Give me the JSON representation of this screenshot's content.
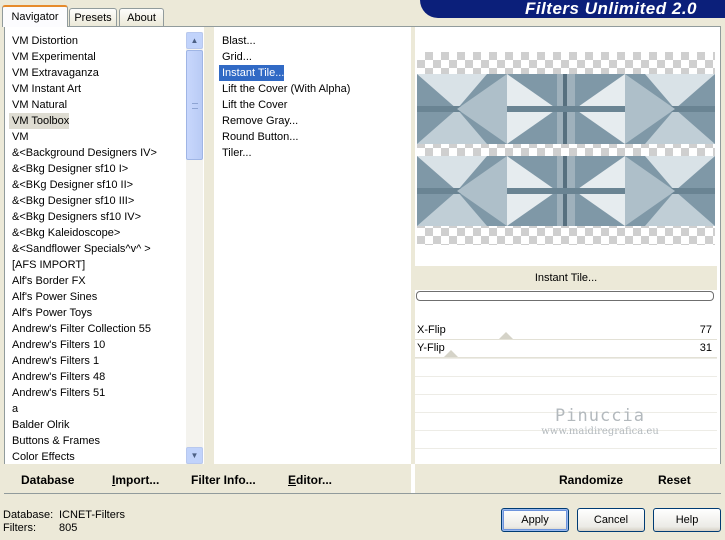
{
  "tabs": [
    {
      "label": "Navigator",
      "active": true
    },
    {
      "label": "Presets",
      "active": false
    },
    {
      "label": "About",
      "active": false
    }
  ],
  "app_title": "Filters Unlimited 2.0",
  "categories": [
    "VM Distortion",
    "VM Experimental",
    "VM Extravaganza",
    "VM Instant Art",
    "VM Natural",
    "VM Toolbox",
    "VM",
    "&<Background Designers IV>",
    "&<Bkg Designer sf10 I>",
    "&<BKg Designer sf10 II>",
    "&<Bkg Designer sf10 III>",
    "&<Bkg Designers sf10 IV>",
    "&<Bkg Kaleidoscope>",
    "&<Sandflower Specials^v^ >",
    "[AFS IMPORT]",
    "Alf's Border FX",
    "Alf's Power Sines",
    "Alf's Power Toys",
    "Andrew's Filter Collection 55",
    "Andrew's Filters 10",
    "Andrew's Filters 1",
    "Andrew's Filters 48",
    "Andrew's Filters 51",
    "a",
    "Balder Olrik",
    "Buttons & Frames",
    "Color Effects"
  ],
  "selected_category": "VM Toolbox",
  "filters": [
    "Blast...",
    "Grid...",
    "Instant Tile...",
    "Lift the Cover (With Alpha)",
    "Lift the Cover",
    "Remove Gray...",
    "Round Button...",
    "Tiler..."
  ],
  "selected_filter": "Instant Tile...",
  "preview": {
    "filter_name": "Instant Tile...",
    "tile_color": "#7e97a6"
  },
  "params": [
    {
      "label": "X-Flip",
      "value": "77",
      "fraction": 0.3
    },
    {
      "label": "Y-Flip",
      "value": "31",
      "fraction": 0.12
    }
  ],
  "watermark": {
    "line1": "Pinuccia",
    "line2": "www.maidiregrafica.eu"
  },
  "bottom_links": [
    {
      "label": "Database",
      "underline": ""
    },
    {
      "label": "Import...",
      "underline": "I"
    },
    {
      "label": "Filter Info...",
      "underline": ""
    },
    {
      "label": "Editor...",
      "underline": "E"
    }
  ],
  "randomize_label": "Randomize",
  "reset_label": "Reset",
  "status": {
    "database_label": "Database:",
    "database_value": "ICNET-Filters",
    "filters_label": "Filters:",
    "filters_value": "805"
  },
  "buttons": {
    "apply": "Apply",
    "cancel": "Cancel",
    "help": "Help"
  },
  "colors": {
    "selection_blue": "#316ac5",
    "title_banner": "#0b1f7a",
    "dialog_bg": "#ece9d8"
  }
}
